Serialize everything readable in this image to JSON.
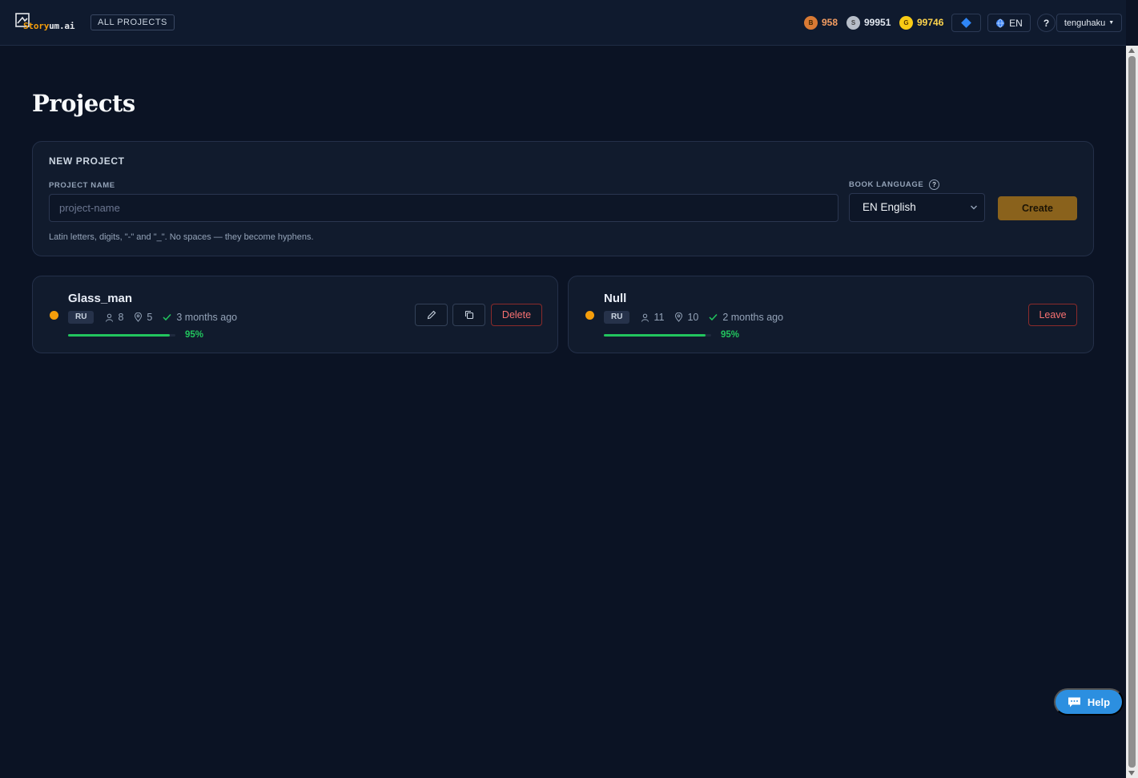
{
  "header": {
    "logo_part1": "Story",
    "logo_part2": "um.ai",
    "all_projects_label": "ALL PROJECTS",
    "coins": [
      {
        "symbol": "B",
        "value": "958"
      },
      {
        "symbol": "S",
        "value": "99951"
      },
      {
        "symbol": "G",
        "value": "99746"
      }
    ],
    "language_label": "EN",
    "help_label": "?",
    "username": "tenguhaku",
    "icons": [
      "diamond-icon",
      "globe-icon",
      "caret-down-icon"
    ]
  },
  "page": {
    "title": "Projects"
  },
  "new_project": {
    "heading": "NEW PROJECT",
    "name_label": "PROJECT NAME",
    "name_placeholder": "project-name",
    "name_value": "",
    "hint": "Latin letters, digits, \"-\" and \"_\". No spaces — they become hyphens.",
    "language_label": "BOOK LANGUAGE",
    "language_help": "?",
    "language_selected": "EN English",
    "create_label": "Create"
  },
  "projects": [
    {
      "name": "Glass_man",
      "lang": "RU",
      "characters": "8",
      "locations": "5",
      "updated": "3 months ago",
      "progress_percent": 95,
      "progress_label": "95%",
      "status_color": "#f59e0b",
      "action_label": "Delete",
      "icons": [
        "pencil-icon",
        "copy-icon"
      ]
    },
    {
      "name": "Null",
      "lang": "RU",
      "characters": "11",
      "locations": "10",
      "updated": "2 months ago",
      "progress_percent": 95,
      "progress_label": "95%",
      "status_color": "#f59e0b",
      "action_label": "Leave",
      "icons": []
    }
  ],
  "help_fab": {
    "label": "Help",
    "icon": "chat-icon"
  },
  "colors": {
    "background": "#0b1324",
    "accent": "#8a621c",
    "success": "#22c55e",
    "danger": "#f87171"
  }
}
